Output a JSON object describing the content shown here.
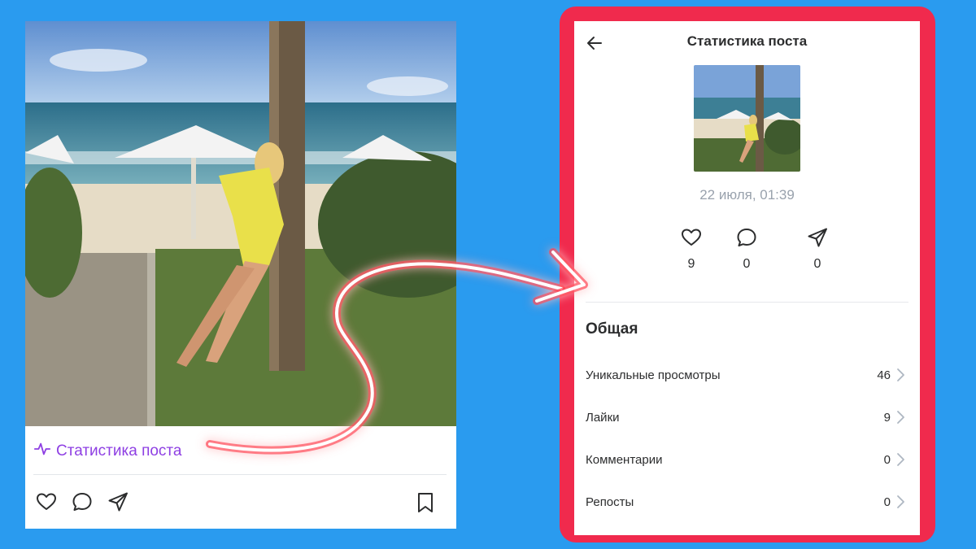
{
  "left_card": {
    "photo_alt": "",
    "stats_link": {
      "icon": "activity-icon",
      "label": "Статистика поста"
    },
    "actions": [
      "heart-icon",
      "comment-icon",
      "share-icon"
    ],
    "bookmark_icon": "bookmark-icon"
  },
  "stats_screen": {
    "title": "Статистика поста",
    "back_icon": "arrow-left-icon",
    "date": "22 июля, 01:39",
    "counters": [
      {
        "icon": "heart-icon",
        "count": "9"
      },
      {
        "icon": "comment-icon",
        "count": "0"
      },
      {
        "icon": "share-icon",
        "count": "0"
      }
    ],
    "section_title": "Общая",
    "rows": [
      {
        "label": "Уникальные просмотры",
        "value": "46"
      },
      {
        "label": "Лайки",
        "value": "9"
      },
      {
        "label": "Комментарии",
        "value": "0"
      },
      {
        "label": "Репосты",
        "value": "0"
      }
    ]
  },
  "colors": {
    "background": "#2a9bef",
    "frame": "#f02a4d",
    "link": "#8e3fe3",
    "text": "#2c2d2e",
    "muted": "#99a2ad"
  }
}
